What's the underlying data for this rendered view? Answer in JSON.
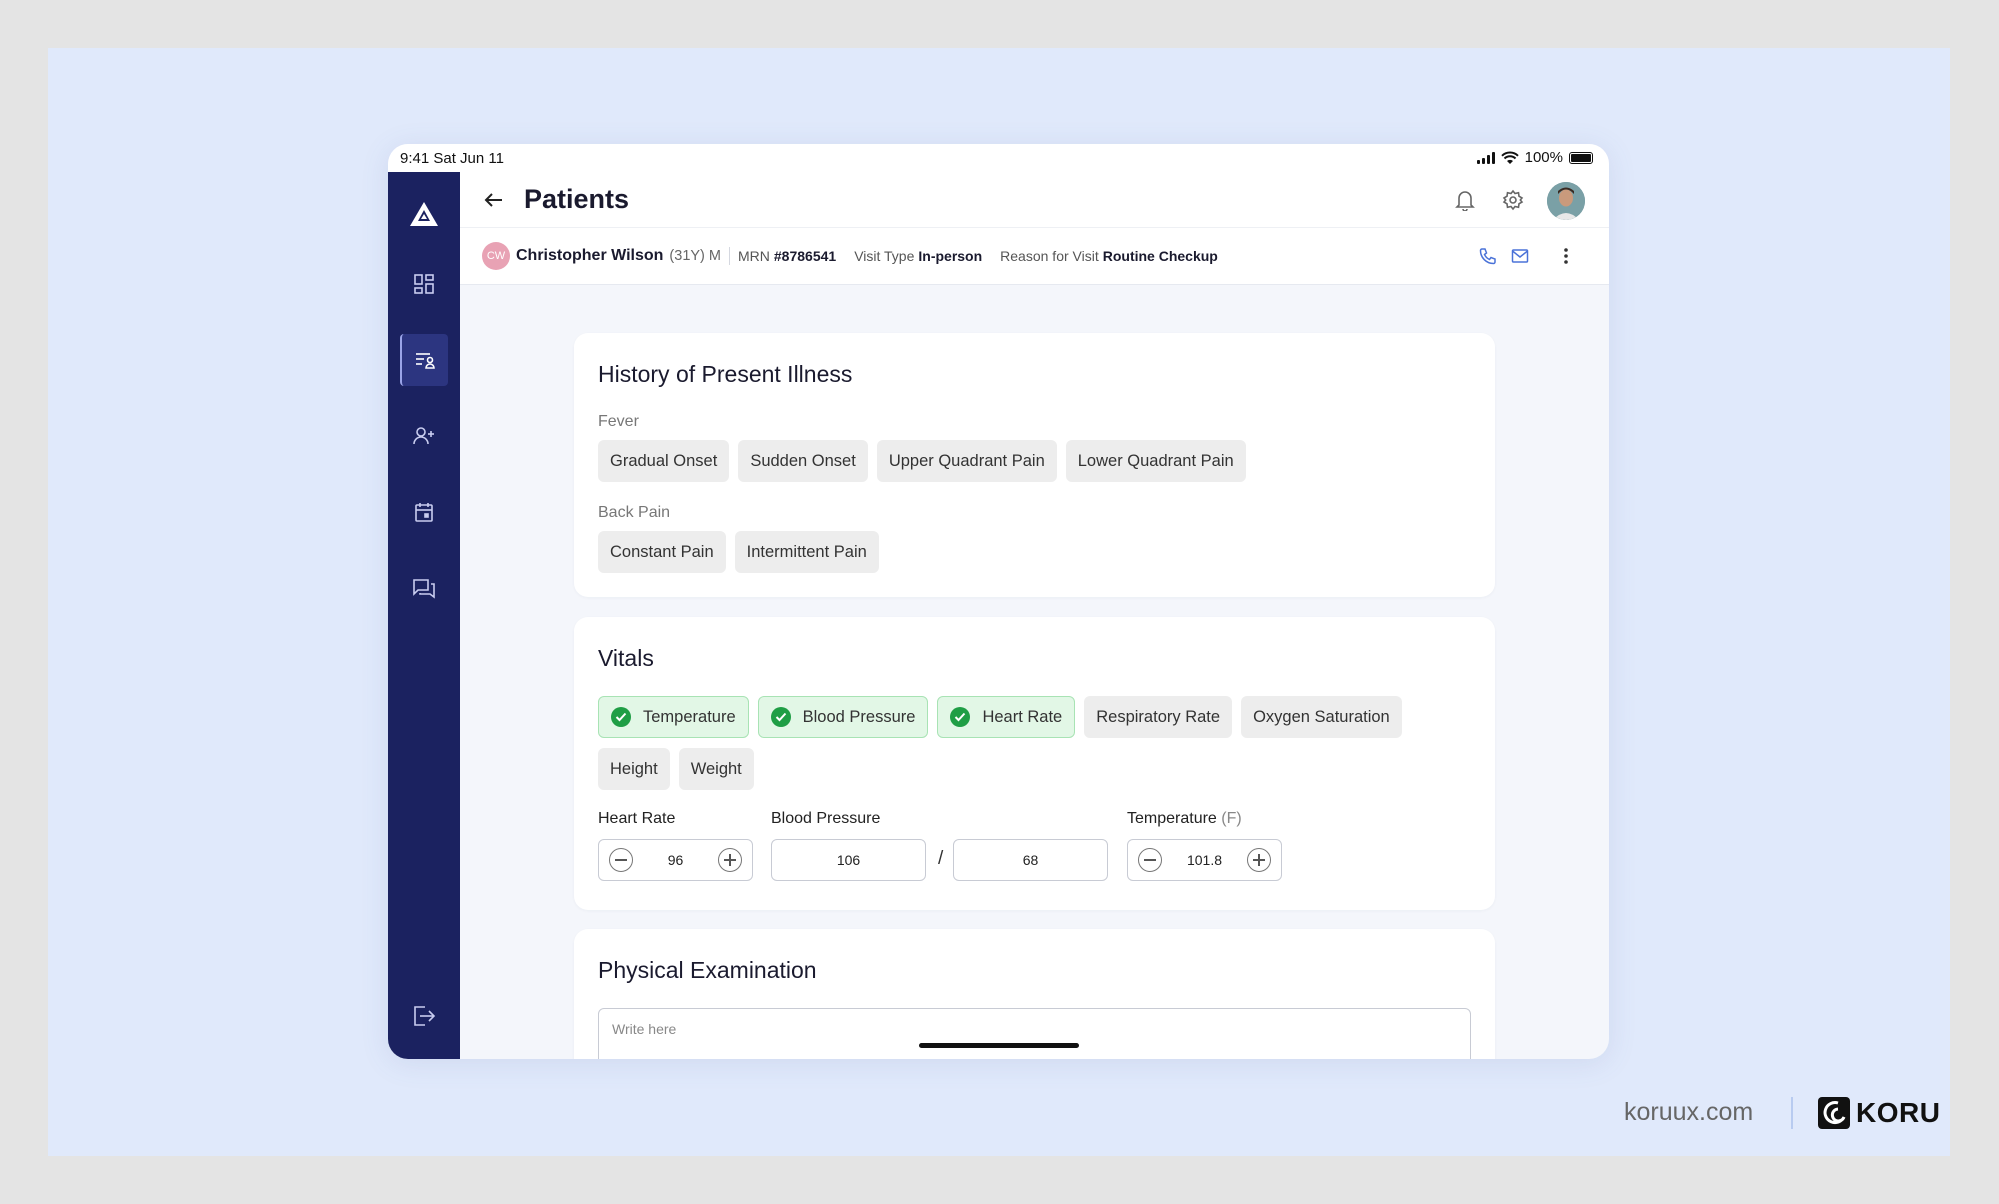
{
  "status_bar": {
    "time": "9:41  Sat Jun 11",
    "battery": "100%"
  },
  "header": {
    "title": "Patients"
  },
  "patient": {
    "initials": "CW",
    "name": "Christopher Wilson",
    "age_sex": "(31Y) M",
    "mrn_label": "MRN",
    "mrn": "#8786541",
    "visit_type_label": "Visit Type",
    "visit_type": "In-person",
    "reason_label": "Reason for Visit",
    "reason": "Routine Checkup"
  },
  "hpi": {
    "title": "History of Present Illness",
    "groups": [
      {
        "label": "Fever",
        "chips": [
          "Gradual Onset",
          "Sudden Onset",
          "Upper Quadrant Pain",
          "Lower Quadrant Pain"
        ]
      },
      {
        "label": "Back Pain",
        "chips": [
          "Constant Pain",
          "Intermittent Pain"
        ]
      }
    ]
  },
  "vitals": {
    "title": "Vitals",
    "chips_row1": [
      {
        "label": "Temperature",
        "selected": true
      },
      {
        "label": "Blood Pressure",
        "selected": true
      },
      {
        "label": "Heart Rate",
        "selected": true
      },
      {
        "label": "Respiratory Rate",
        "selected": false
      },
      {
        "label": "Oxygen Saturation",
        "selected": false
      }
    ],
    "chips_row2": [
      {
        "label": "Height",
        "selected": false
      },
      {
        "label": "Weight",
        "selected": false
      }
    ],
    "heart_rate": {
      "label": "Heart Rate",
      "value": "96"
    },
    "blood_pressure": {
      "label": "Blood Pressure",
      "systolic": "106",
      "separator": "/",
      "diastolic": "68"
    },
    "temperature": {
      "label": "Temperature",
      "unit": "(F)",
      "value": "101.8"
    }
  },
  "physical_exam": {
    "title": "Physical Examination",
    "placeholder": "Write here"
  },
  "footer": {
    "site": "koruux.com",
    "brand": "KORU"
  },
  "colors": {
    "sidebar": "#1b2260",
    "selected_chip_bg": "#e2f7e6",
    "check": "#1f9e45",
    "page_bg": "#e0e9fb"
  },
  "icons": [
    "logo-icon",
    "dashboard-icon",
    "patients-list-icon",
    "add-user-icon",
    "calendar-icon",
    "chat-icon",
    "logout-icon",
    "back-arrow-icon",
    "bell-icon",
    "gear-icon",
    "phone-icon",
    "mail-icon",
    "more-vertical-icon",
    "check-icon",
    "minus-icon",
    "plus-icon"
  ]
}
